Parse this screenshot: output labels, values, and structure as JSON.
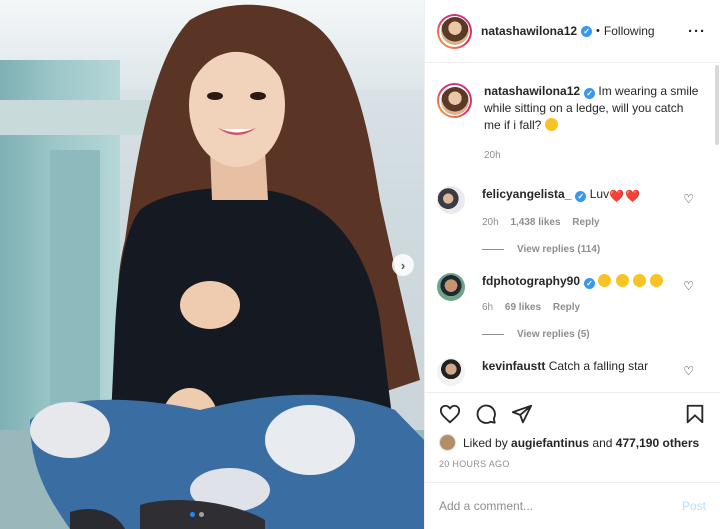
{
  "post": {
    "username": "natashawilona12",
    "follow_state": "Following",
    "more_icon": "more-horizontal-icon",
    "photo_nav_icon": "chevron-right-icon",
    "caption": {
      "username": "natashawilona12",
      "text": "Im wearing a smile while sitting on a ledge, will you catch me if i fall?",
      "time": "20h"
    },
    "comments": [
      {
        "username": "felicyangelista_",
        "text": "Luv",
        "time": "20h",
        "likes": "1,438 likes",
        "reply": "Reply",
        "view_replies": "View replies (114)"
      },
      {
        "username": "fdphotography90",
        "text": "",
        "time": "6h",
        "likes": "69 likes",
        "reply": "Reply",
        "view_replies": "View replies (5)"
      },
      {
        "username": "kevinfaustt",
        "text": "Catch a falling star"
      }
    ],
    "liked_by": {
      "prefix": "Liked by",
      "user": "augiefantinus",
      "connector": "and",
      "others": "477,190 others"
    },
    "timestamp": "20 HOURS AGO",
    "comment_input": {
      "placeholder": "Add a comment...",
      "value": ""
    },
    "post_button": "Post",
    "colors": {
      "accent": "#3897f0",
      "post_disabled": "#b2dffc",
      "heart": "#e0245e"
    }
  }
}
